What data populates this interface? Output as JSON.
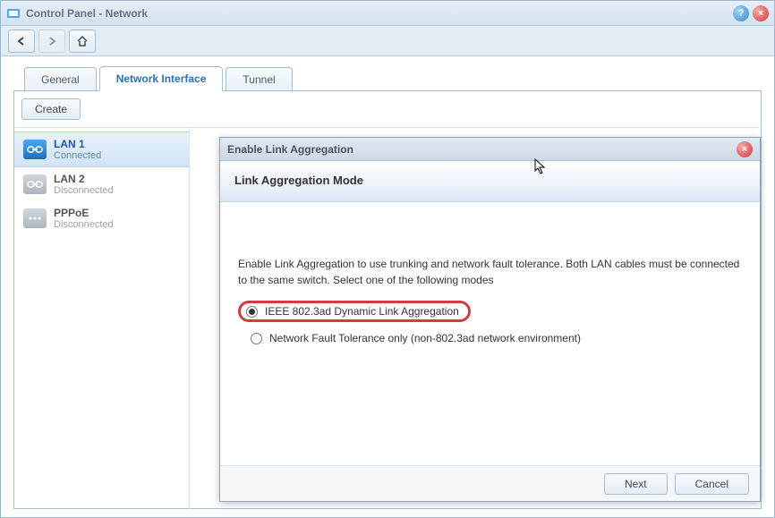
{
  "window": {
    "title": "Control Panel - Network"
  },
  "tabs": {
    "general": "General",
    "network_interface": "Network Interface",
    "tunnel": "Tunnel"
  },
  "toolbar": {
    "create": "Create"
  },
  "interfaces": [
    {
      "name": "LAN 1",
      "status": "Connected"
    },
    {
      "name": "LAN 2",
      "status": "Disconnected"
    },
    {
      "name": "PPPoE",
      "status": "Disconnected"
    }
  ],
  "modal": {
    "title": "Enable Link Aggregation",
    "heading": "Link Aggregation Mode",
    "description": "Enable Link Aggregation to use trunking and network fault tolerance. Both LAN cables must be connected to the same switch. Select one of the following modes",
    "option1": "IEEE 802.3ad Dynamic Link Aggregation",
    "option2": "Network Fault Tolerance only (non-802.3ad network environment)",
    "next": "Next",
    "cancel": "Cancel"
  }
}
